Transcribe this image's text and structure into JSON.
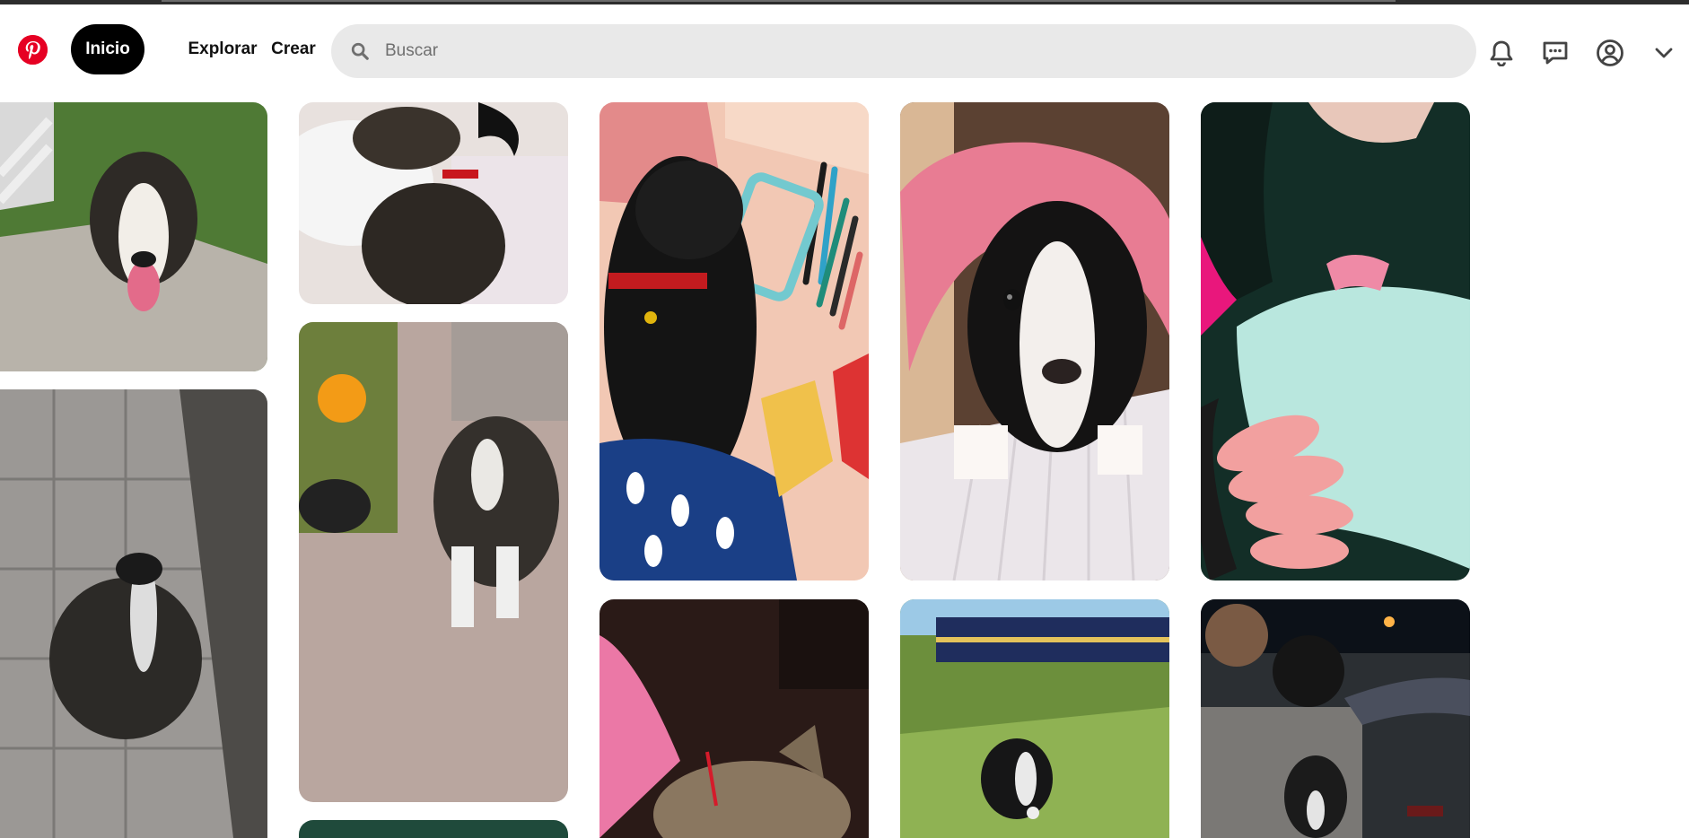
{
  "header": {
    "logo_icon": "pinterest-logo",
    "nav": {
      "home_label": "Inicio",
      "explore_label": "Explorar",
      "create_label": "Crear"
    },
    "search": {
      "placeholder": "Buscar",
      "value": "",
      "icon": "search-icon"
    },
    "icons": [
      "bell-icon",
      "message-icon",
      "user-circle-icon",
      "chevron-down-icon"
    ]
  },
  "colors": {
    "brand": "#e60023",
    "active_nav_bg": "#000000",
    "search_bg": "#e9e9e9"
  },
  "pins": [
    {
      "subject": "dog-on-grass"
    },
    {
      "subject": "puppy-sleeping-on-bed"
    },
    {
      "subject": "black-puppy-with-markers"
    },
    {
      "subject": "puppy-in-pink-jacket"
    },
    {
      "subject": "hands-with-fluffy-blanket"
    },
    {
      "subject": "dog-on-tiles"
    },
    {
      "subject": "puppy-next-to-marigold"
    },
    {
      "subject": "cat-with-red-collar"
    },
    {
      "subject": "puppy-on-grass"
    },
    {
      "subject": "puppy-at-night"
    },
    {
      "subject": "partial-pin"
    }
  ]
}
